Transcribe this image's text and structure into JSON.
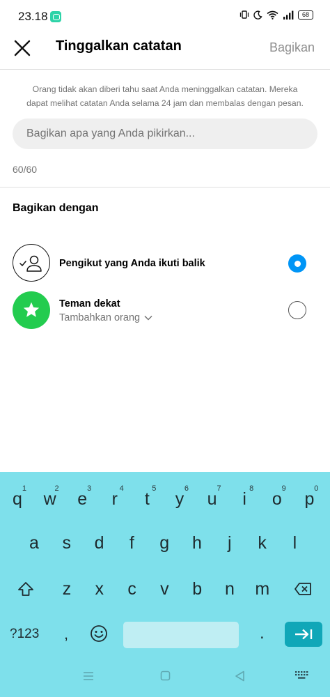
{
  "status": {
    "time": "23.18",
    "battery": "68",
    "icons": [
      "message-app-icon",
      "vibrate-icon",
      "moon-icon",
      "wifi-icon",
      "signal-icon",
      "battery-icon"
    ]
  },
  "header": {
    "title": "Tinggalkan catatan",
    "share_label": "Bagikan"
  },
  "info_text": "Orang tidak akan diberi tahu saat Anda meninggalkan catatan. Mereka dapat melihat catatan Anda selama 24 jam dan membalas dengan pesan.",
  "note_input": {
    "placeholder": "Bagikan apa yang Anda pikirkan...",
    "value": ""
  },
  "counter": "60/60",
  "share_with": {
    "title": "Bagikan dengan",
    "options": [
      {
        "label": "Pengikut yang Anda ikuti balik",
        "selected": true
      },
      {
        "label": "Teman dekat",
        "sublabel": "Tambahkan orang",
        "selected": false
      }
    ]
  },
  "keyboard": {
    "row1": [
      {
        "l": "q",
        "h": "1"
      },
      {
        "l": "w",
        "h": "2"
      },
      {
        "l": "e",
        "h": "3"
      },
      {
        "l": "r",
        "h": "4"
      },
      {
        "l": "t",
        "h": "5"
      },
      {
        "l": "y",
        "h": "6"
      },
      {
        "l": "u",
        "h": "7"
      },
      {
        "l": "i",
        "h": "8"
      },
      {
        "l": "o",
        "h": "9"
      },
      {
        "l": "p",
        "h": "0"
      }
    ],
    "row2": [
      "a",
      "s",
      "d",
      "f",
      "g",
      "h",
      "j",
      "k",
      "l"
    ],
    "row3": [
      "z",
      "x",
      "c",
      "v",
      "b",
      "n",
      "m"
    ],
    "symbols_label": "?123",
    "comma": ",",
    "period": "."
  },
  "colors": {
    "accent": "#0095f6",
    "close_friends": "#23cc4f",
    "keyboard_bg": "#7ee0eb",
    "enter_key": "#10a7b8"
  }
}
